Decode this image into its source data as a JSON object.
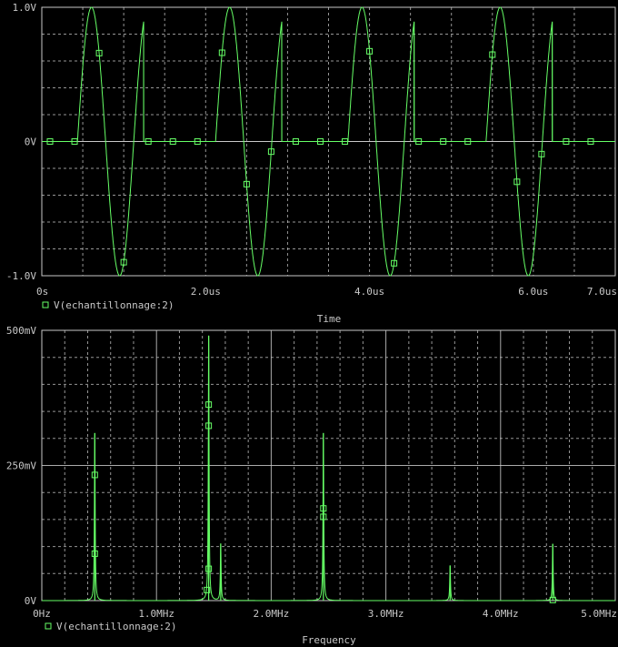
{
  "colors": {
    "background": "#000000",
    "trace": "#66ff66",
    "grid": "#c8c8c8",
    "text": "#c8c8c8"
  },
  "chart_data": [
    {
      "type": "line",
      "title": "",
      "xlabel": "Time",
      "ylabel": "",
      "xlim": [
        0,
        7.0
      ],
      "ylim": [
        -1.0,
        1.0
      ],
      "x_unit": "us",
      "x_ticks": [
        0,
        2.0,
        4.0,
        6.0,
        7.0
      ],
      "x_tick_labels": [
        "0s",
        "2.0us",
        "4.0us",
        "6.0us",
        "7.0us"
      ],
      "y_ticks": [
        -1.0,
        0,
        1.0
      ],
      "y_tick_labels": [
        "-1.0V",
        "0V",
        "1.0V"
      ],
      "grid": true,
      "legend_position": "bottom-left",
      "series": [
        {
          "name": "V(echantillonnage:2)",
          "segments": [
            {
              "start": 0.0,
              "end": 0.435,
              "freq_mhz": 1.455,
              "on": false
            },
            {
              "start": 0.435,
              "end": 1.243,
              "freq_mhz": 1.455,
              "on": true
            },
            {
              "start": 1.243,
              "end": 2.121,
              "freq_mhz": 1.455,
              "on": false
            },
            {
              "start": 2.121,
              "end": 2.929,
              "freq_mhz": 1.455,
              "on": true
            },
            {
              "start": 2.929,
              "end": 3.737,
              "freq_mhz": 1.455,
              "on": false
            },
            {
              "start": 3.737,
              "end": 4.545,
              "freq_mhz": 1.455,
              "on": true
            },
            {
              "start": 4.545,
              "end": 5.423,
              "freq_mhz": 1.455,
              "on": false
            },
            {
              "start": 5.423,
              "end": 6.231,
              "freq_mhz": 1.455,
              "on": true
            },
            {
              "start": 6.231,
              "end": 7.0,
              "freq_mhz": 1.455,
              "on": false
            }
          ]
        }
      ]
    },
    {
      "type": "line",
      "title": "",
      "xlabel": "Frequency",
      "ylabel": "",
      "xlim": [
        0,
        5.0
      ],
      "ylim": [
        0,
        500
      ],
      "x_unit": "MHz",
      "x_ticks": [
        0,
        1.0,
        2.0,
        3.0,
        4.0,
        5.0
      ],
      "x_tick_labels": [
        "0Hz",
        "1.0MHz",
        "2.0MHz",
        "3.0MHz",
        "4.0MHz",
        "5.0MHz"
      ],
      "y_ticks": [
        0,
        250,
        500
      ],
      "y_tick_labels": [
        "0V",
        "250mV",
        "500mV"
      ],
      "grid": true,
      "legend_position": "bottom-left",
      "series": [
        {
          "name": "V(echantillonnage:2)",
          "peaks": [
            {
              "freq_mhz": 0.462,
              "value_mv": 310
            },
            {
              "freq_mhz": 1.455,
              "value_mv": 490
            },
            {
              "freq_mhz": 1.56,
              "value_mv": 105
            },
            {
              "freq_mhz": 2.455,
              "value_mv": 310
            },
            {
              "freq_mhz": 3.56,
              "value_mv": 65
            },
            {
              "freq_mhz": 4.455,
              "value_mv": 105
            }
          ]
        }
      ]
    }
  ]
}
